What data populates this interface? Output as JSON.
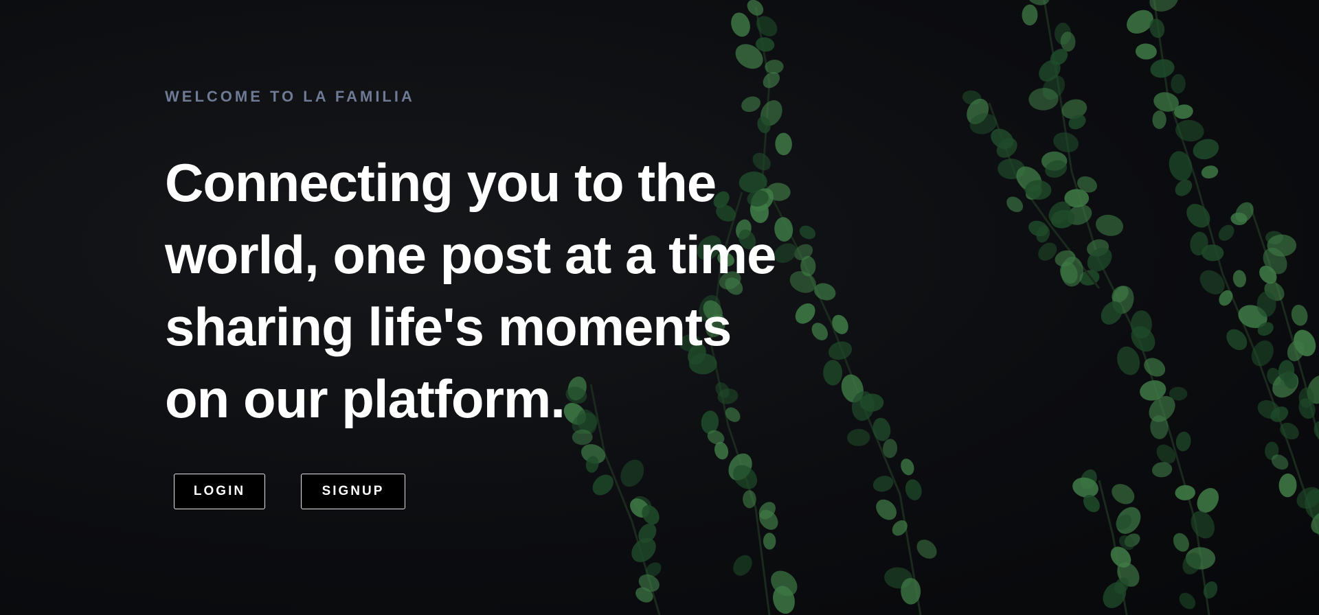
{
  "hero": {
    "eyebrow": "WELCOME TO LA FAMILIA",
    "headline_lines": [
      "Connecting you to the",
      "world, one post at a time",
      "sharing life's moments",
      "on our platform."
    ],
    "background_image": "dark-wall-with-ivy-vines"
  },
  "actions": {
    "login_label": "LOGIN",
    "signup_label": "SIGNUP"
  },
  "colors": {
    "background": "#0b0c0e",
    "eyebrow": "#6f7a94",
    "headline": "#ffffff",
    "button_border": "#e6e6e6",
    "leaf_dark": "#1f4a2a",
    "leaf_light": "#3f7a46"
  }
}
